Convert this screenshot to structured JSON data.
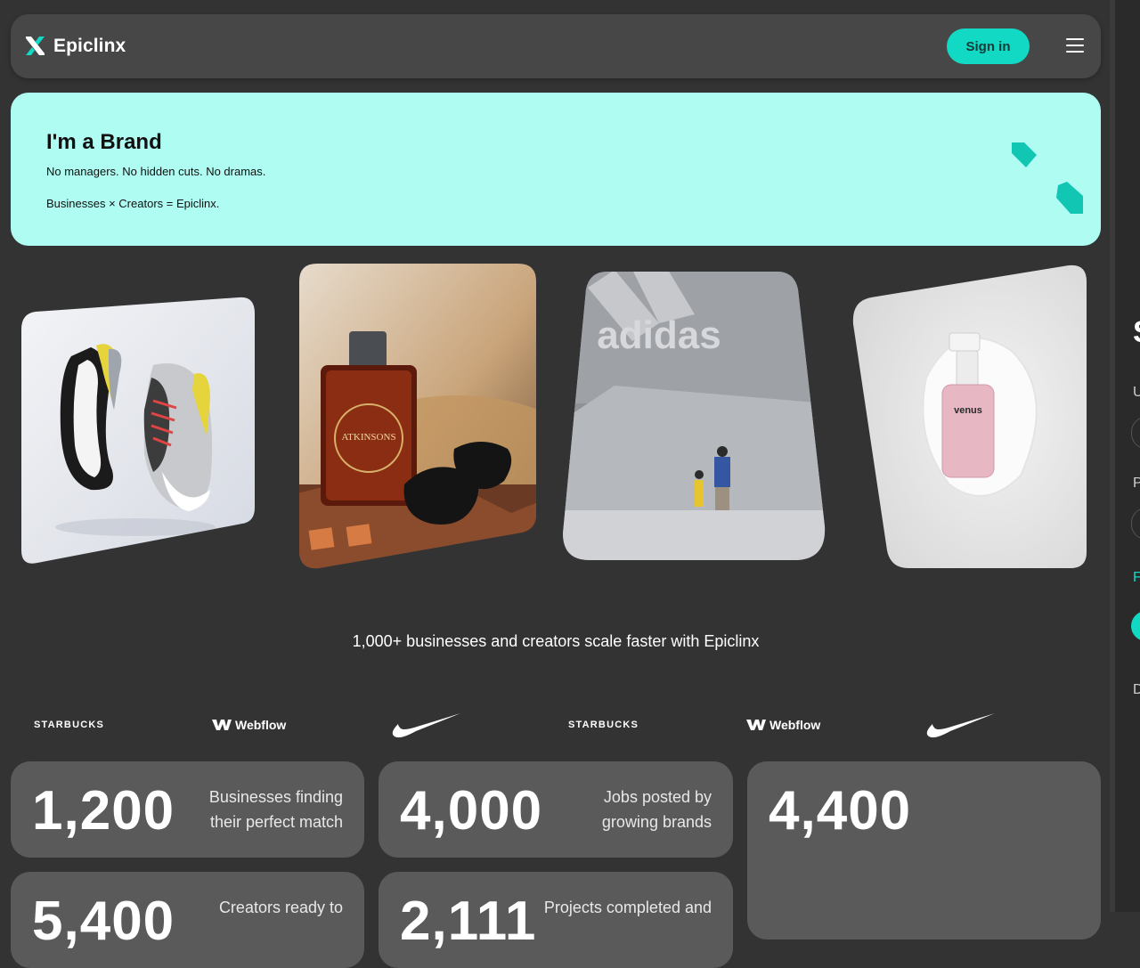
{
  "nav": {
    "brand": "Epiclinx",
    "signin_label": "Sign in"
  },
  "hero": {
    "title": "I'm a Brand",
    "subtitle": "No managers. No hidden cuts. No dramas.",
    "tagline": "Businesses × Creators = Epiclinx."
  },
  "cards": [
    {
      "name": "sneakers-card",
      "caption": "",
      "text": ""
    },
    {
      "name": "perfume-card",
      "caption": "",
      "text": "ATKINSONS"
    },
    {
      "name": "adidas-card",
      "caption": "",
      "text": "adidas"
    },
    {
      "name": "cleanser-card",
      "caption": "",
      "text": "venus"
    }
  ],
  "scale_text": "1,000+ businesses and creators scale faster with Epiclinx",
  "brand_logos": [
    "STARBUCKS",
    "Webflow",
    "nike-swoosh",
    "STARBUCKS",
    "Webflow",
    "nike-swoosh"
  ],
  "stats": [
    {
      "number": "1,200",
      "desc_line1": "Businesses finding",
      "desc_line2": "their perfect match"
    },
    {
      "number": "4,000",
      "desc_line1": "Jobs posted by",
      "desc_line2": "growing brands"
    },
    {
      "number": "4,400",
      "desc_line1": "",
      "desc_line2": ""
    },
    {
      "number": "5,400",
      "desc_line1": "Creators ready to",
      "desc_line2": ""
    },
    {
      "number": "2,111",
      "desc_line1": "Projects completed and",
      "desc_line2": ""
    }
  ],
  "colors": {
    "accent": "#11d9c4",
    "hero_bg": "#aefcf2",
    "page_bg": "#333333",
    "card_bg": "#5a5a5a"
  }
}
